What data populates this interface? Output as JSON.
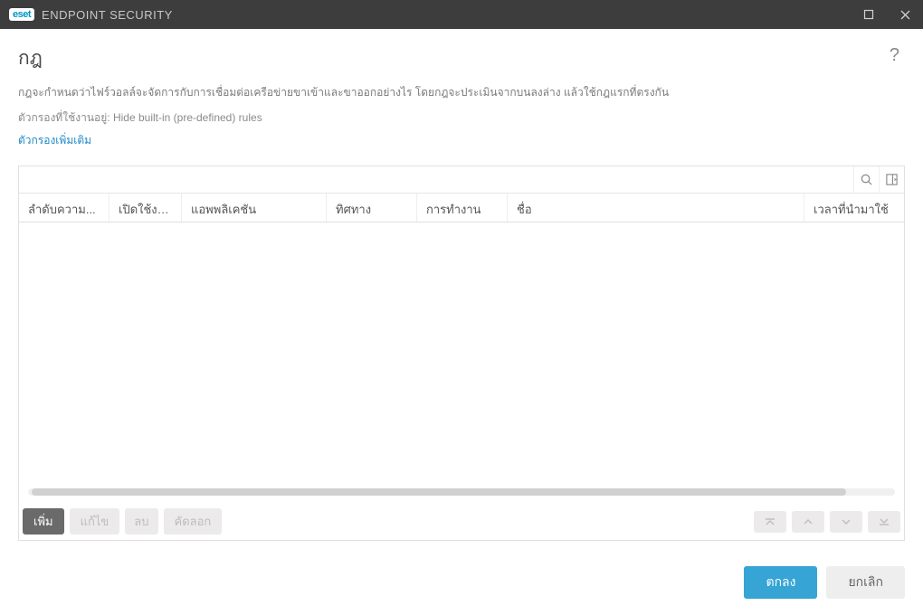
{
  "titlebar": {
    "app_name": "ENDPOINT SECURITY",
    "logo_text": "eset"
  },
  "page": {
    "title": "กฎ",
    "description": "กฎจะกำหนดว่าไฟร์วอลล์จะจัดการกับการเชื่อมต่อเครือข่ายขาเข้าและขาออกอย่างไร โดยกฎจะประเมินจากบนลงล่าง แล้วใช้กฎแรกที่ตรงกัน",
    "active_filter_label": "ตัวกรองที่ใช้งานอยู่:",
    "active_filter_value": "Hide built-in (pre-defined) rules",
    "more_filters": "ตัวกรองเพิ่มเติม"
  },
  "table": {
    "columns": {
      "priority": "ลำดับความ...",
      "enabled": "เปิดใช้งาน...",
      "application": "แอพพลิเคชัน",
      "direction": "ทิศทาง",
      "action": "การทำงาน",
      "name": "ชื่อ",
      "time": "เวลาที่นำมาใช้"
    }
  },
  "actions": {
    "add": "เพิ่ม",
    "edit": "แก้ไข",
    "delete": "ลบ",
    "copy": "คัดลอก"
  },
  "footer": {
    "ok": "ตกลง",
    "cancel": "ยกเลิก"
  }
}
